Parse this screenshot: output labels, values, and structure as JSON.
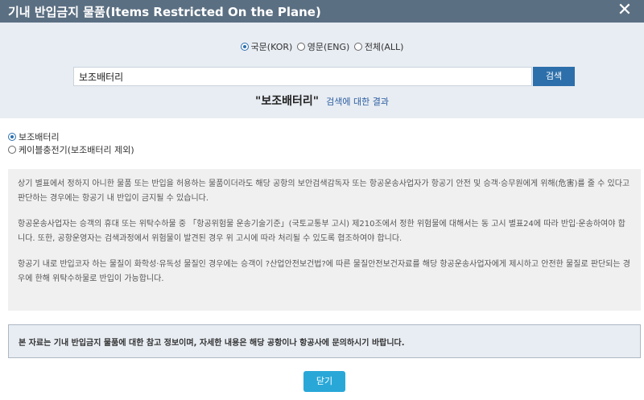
{
  "header": {
    "title": "기내 반입금지 물품(Items Restricted On the Plane)",
    "close_glyph": "✕"
  },
  "search": {
    "lang_options": [
      {
        "label": "국문(KOR)",
        "checked": true
      },
      {
        "label": "영문(ENG)",
        "checked": false
      },
      {
        "label": "전체(ALL)",
        "checked": false
      }
    ],
    "query": "보조배터리",
    "button_label": "검색"
  },
  "result": {
    "term": "\"보조배터리\"",
    "suffix": "검색에 대한 결과"
  },
  "results": [
    {
      "label": "보조배터리",
      "checked": true
    },
    {
      "label": "케이블충전기(보조배터리 제외)",
      "checked": false
    }
  ],
  "info": {
    "paragraphs": [
      "상기 별표에서 정하지 아니한 물품 또는 반입을 허용하는 물품이더라도 해당 공항의 보안검색감독자 또는 항공운송사업자가 항공기 안전 및 승객·승무원에게 위해(危害)를 줄 수 있다고 판단하는 경우에는 항공기 내 반입이 금지될 수 있습니다.",
      "항공운송사업자는 승객의 휴대 또는 위탁수하물 중 「항공위험물 운송기술기준」(국토교통부 고시) 제210조에서 정한 위험물에 대해서는 동 고시 별표24에 따라 반입·운송하여야 합니다. 또한, 공항운영자는 검색과정에서 위험물이 발견된 경우 위 고시에 따라 처리될 수 있도록 협조하여야 합니다.",
      "항공기 내로 반입코자 하는 물질이 화학성·유독성 물질인 경우에는 승객이 ?산업안전보건법?에 따른 물질안전보건자료를 해당 항공운송사업자에게 제시하고 안전한 물질로 판단되는 경우에 한해 위탁수하물로 반입이 가능합니다."
    ]
  },
  "notice": "본 자료는 기내 반입금지 물품에 대한 참고 정보이며, 자세한 내용은 해당 공항이나 항공사에 문의하시기 바랍니다.",
  "footer": {
    "close_label": "닫기"
  },
  "colors": {
    "header_bg": "#5b6f82",
    "panel_bg": "#e8edf3",
    "search_button": "#2d6faa",
    "close_button": "#29a8d8",
    "result_link": "#2b5da0"
  }
}
